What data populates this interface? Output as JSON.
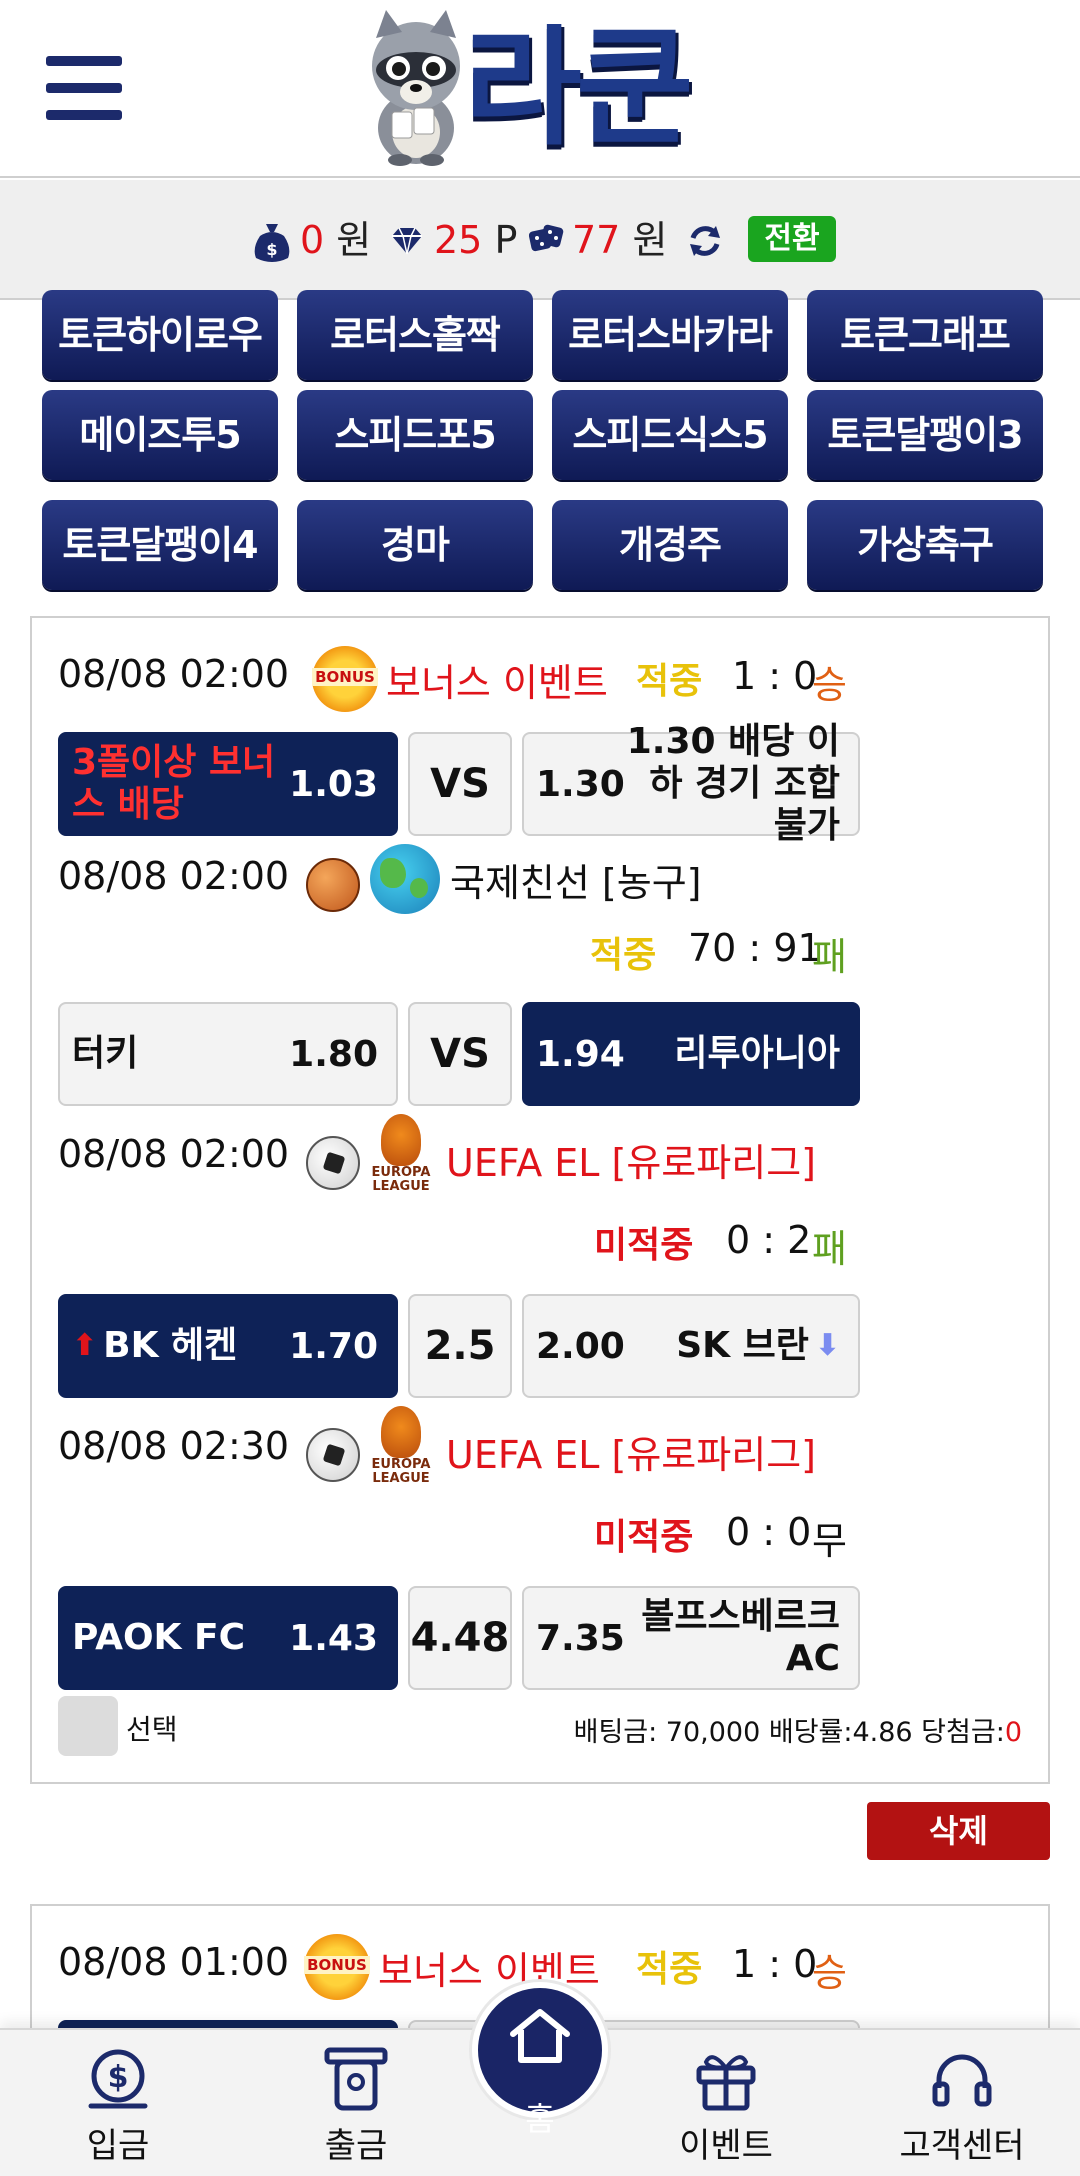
{
  "header": {
    "logo_text": "라쿤"
  },
  "balance": {
    "cash_value": "0",
    "cash_unit": "원",
    "point_value": "25",
    "point_unit": "P",
    "casino_value": "77",
    "casino_unit": "원",
    "switch_label": "전환"
  },
  "games": [
    "토큰하이로우",
    "로터스홀짝",
    "로터스바카라",
    "토큰그래프",
    "메이즈투5",
    "스피드포5",
    "스피드식스5",
    "토큰달팽이3",
    "토큰달팽이4",
    "경마",
    "개경주",
    "가상축구"
  ],
  "slip1": {
    "rows": [
      {
        "datetime": "08/08 02:00",
        "league": "보너스 이벤트",
        "league_color": "#e0141b",
        "status": "적중",
        "score": "1 : 0",
        "result": "승",
        "home_label": "3폴이상 보너스 배당",
        "home_odd": "1.03",
        "mid": "VS",
        "away_odd": "1.30",
        "away_label": "1.30 배당 이하 경기 조합 불가"
      },
      {
        "datetime": "08/08 02:00",
        "league": "국제친선 [농구]",
        "league_color": "#111111",
        "status": "적중",
        "score": "70 : 91",
        "result": "패",
        "home_label": "터키",
        "home_odd": "1.80",
        "mid": "VS",
        "away_odd": "1.94",
        "away_label": "리투아니아"
      },
      {
        "datetime": "08/08 02:00",
        "league": "UEFA EL [유로파리그]",
        "league_color": "#e0141b",
        "status": "미적중",
        "score": "0 : 2",
        "result": "패",
        "home_label": "BK 헤켄",
        "home_odd": "1.70",
        "mid": "2.5",
        "away_odd": "2.00",
        "away_label": "SK 브란"
      },
      {
        "datetime": "08/08 02:30",
        "league": "UEFA EL [유로파리그]",
        "league_color": "#e0141b",
        "status": "미적중",
        "score": "0 : 0",
        "result": "무",
        "home_label": "PAOK FC",
        "home_odd": "1.43",
        "mid": "4.48",
        "away_odd": "7.35",
        "away_label": "볼프스베르크 AC"
      }
    ],
    "select_label": "선택",
    "summary_prefix": "배팅금: 70,000 배당률:4.86 당첨금:",
    "summary_win": "0",
    "delete_label": "삭제"
  },
  "slip2": {
    "datetime": "08/08 01:00",
    "league": "보너스 이벤트",
    "status": "적중",
    "score": "1 : 0",
    "result": "승"
  },
  "icons": {
    "bonus_text": "BONUS",
    "europa_text": "EUROPA LEAGUE"
  },
  "nav": [
    {
      "label": "입금",
      "icon": "coin-deposit-icon"
    },
    {
      "label": "출금",
      "icon": "atm-withdraw-icon"
    },
    {
      "label": "홈",
      "icon": "home-icon"
    },
    {
      "label": "이벤트",
      "icon": "gift-icon"
    },
    {
      "label": "고객센터",
      "icon": "headset-icon"
    }
  ]
}
